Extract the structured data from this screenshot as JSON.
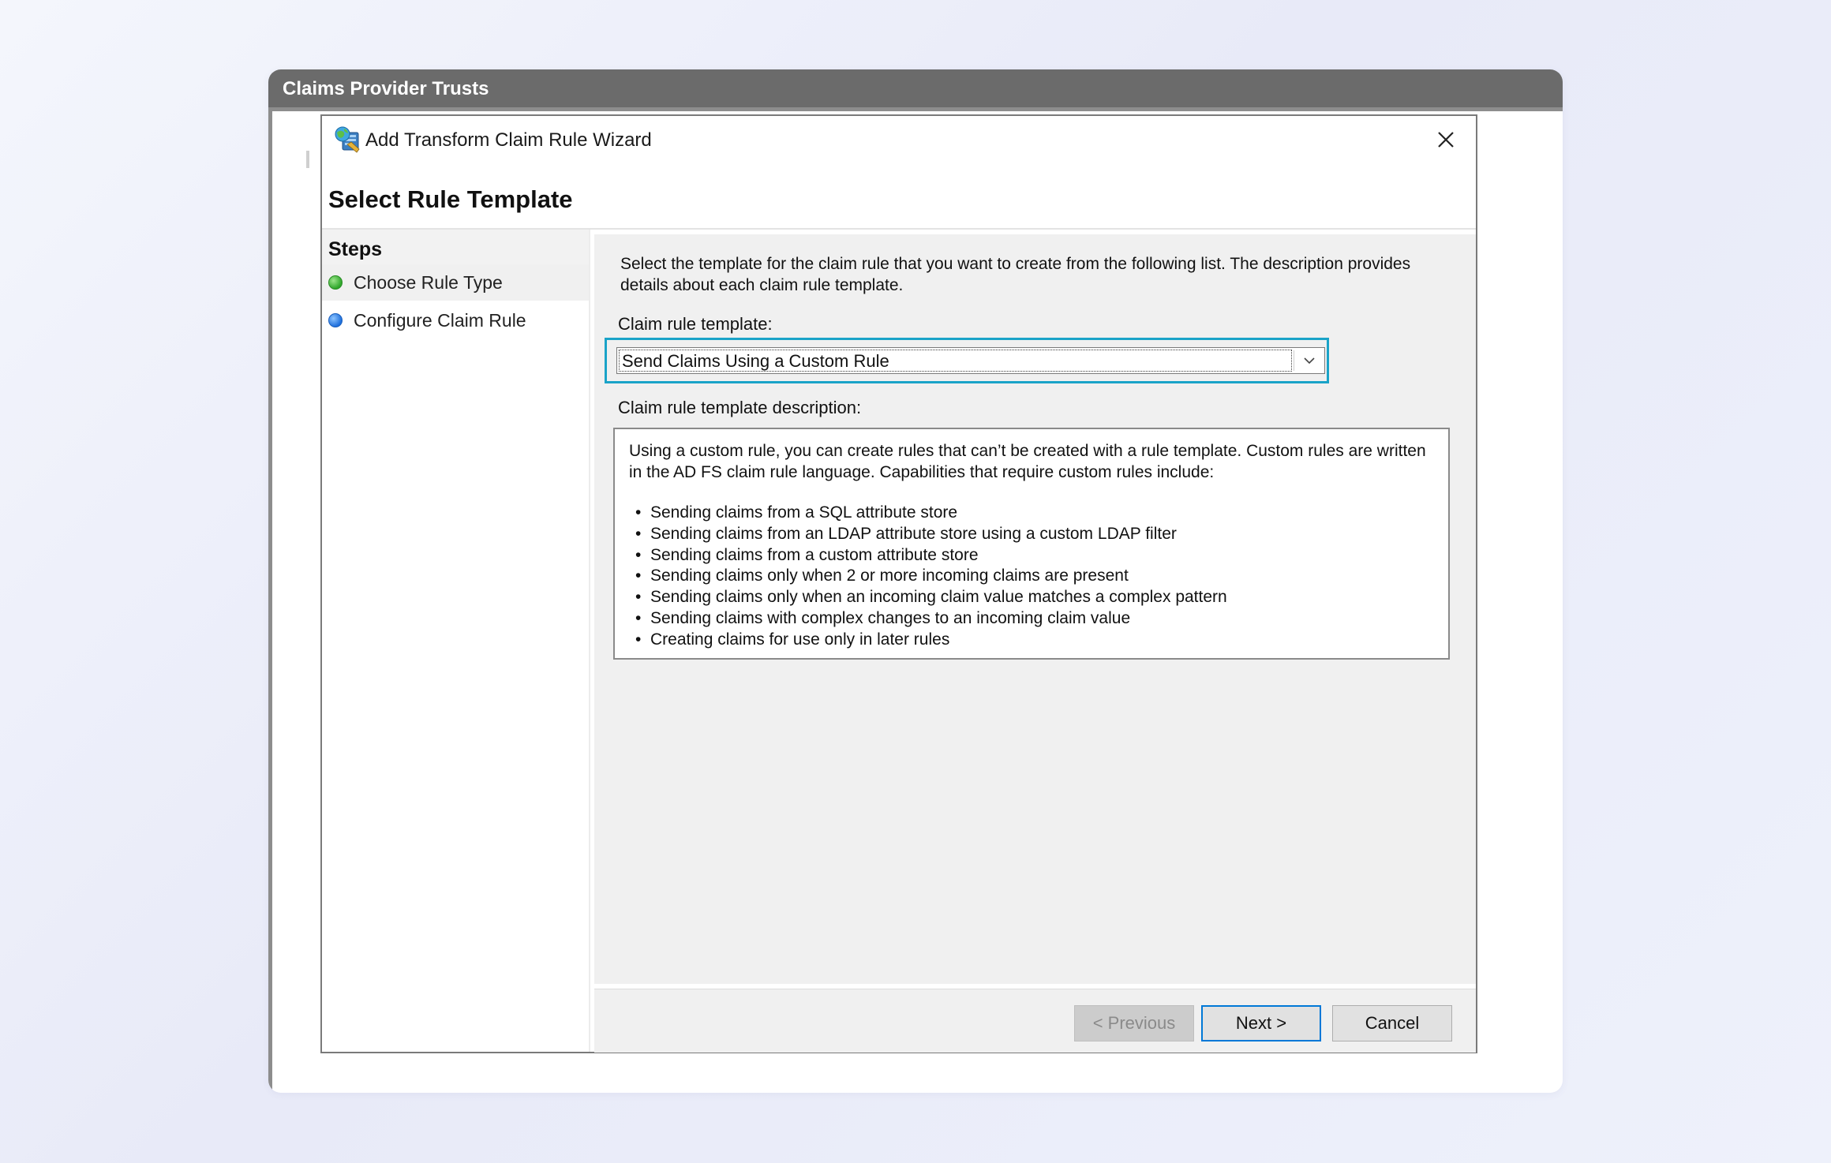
{
  "outer_window": {
    "title": "Claims Provider Trusts"
  },
  "dialog": {
    "title": "Add Transform Claim Rule Wizard",
    "icon": "wizard-app-icon",
    "close_icon": "close-icon",
    "heading": "Select Rule Template"
  },
  "steps": {
    "heading": "Steps",
    "items": [
      {
        "label": "Choose Rule Type",
        "status": "completed",
        "dot_color": "#2ea62a"
      },
      {
        "label": "Configure Claim Rule",
        "status": "current",
        "dot_color": "#1e6fdc"
      }
    ]
  },
  "content": {
    "intro": "Select the template for the claim rule that you want to create from the following list. The description provides details about each claim rule template.",
    "template_label": "Claim rule template:",
    "template_selected": "Send Claims Using a Custom Rule",
    "description_label": "Claim rule template description:",
    "description_intro": "Using a custom rule, you can create rules that can’t be created with a rule template.  Custom rules are written in the AD FS claim rule language.  Capabilities that require custom rules include:",
    "description_items": [
      "Sending claims from a SQL attribute store",
      "Sending claims from an LDAP attribute store using a custom LDAP filter",
      "Sending claims from a custom attribute store",
      "Sending claims only when 2 or more incoming claims are present",
      "Sending claims only when an incoming claim value matches a complex pattern",
      "Sending claims with complex changes to an incoming claim value",
      "Creating claims for use only in later rules"
    ]
  },
  "buttons": {
    "previous": "< Previous",
    "next": "Next >",
    "cancel": "Cancel"
  },
  "colors": {
    "highlight": "#1aa3c8",
    "default_button_border": "#0078d7",
    "titlebar": "#6b6b6b"
  }
}
